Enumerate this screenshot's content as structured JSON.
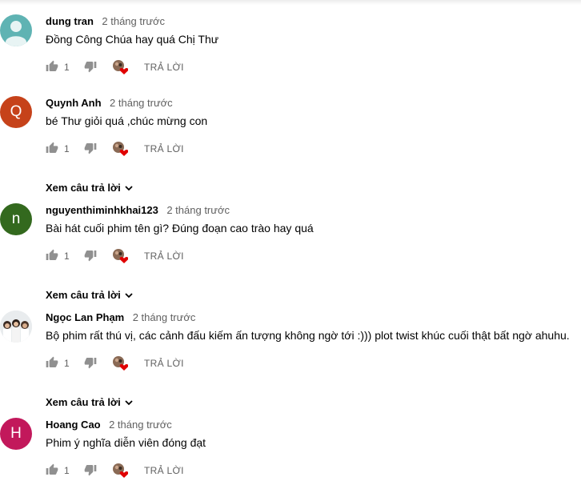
{
  "like_label": "1",
  "reply_label": "TRẢ LỜI",
  "view_replies_label": "Xem câu trả lời",
  "comments": [
    {
      "author": "dung tran",
      "time": "2 tháng trước",
      "text": "Đồng Công Chúa hay quá Chị Thư",
      "avatar_type": "default-user",
      "avatar_color": "#5fb3b3"
    },
    {
      "author": "Quynh Anh",
      "time": "2 tháng trước",
      "text": "bé Thư giỏi quá ,chúc mừng con",
      "avatar_letter": "Q",
      "avatar_color": "#c6421a"
    },
    {
      "author": "nguyenthiminhkhai123",
      "time": "2 tháng trước",
      "text": "Bài hát cuối phim tên gì? Đúng đoạn cao trào hay quá",
      "avatar_letter": "n",
      "avatar_color": "#33691e"
    },
    {
      "author": "Ngọc Lan Phạm",
      "time": "2 tháng trước",
      "text": "Bộ phim rất thú vị, các cảnh đấu kiếm ấn tượng không ngờ tới :))) plot twist khúc cuối thật bất ngờ ahuhu.",
      "avatar_type": "group-photo"
    },
    {
      "author": "Hoang Cao",
      "time": "2 tháng trước",
      "text": "Phim ý nghĩa diễn viên đóng đạt",
      "avatar_letter": "H",
      "avatar_color": "#c2185b"
    }
  ],
  "colors": {
    "secondary_text": "#606060",
    "primary_text": "#030303",
    "heart": "#e00000"
  }
}
